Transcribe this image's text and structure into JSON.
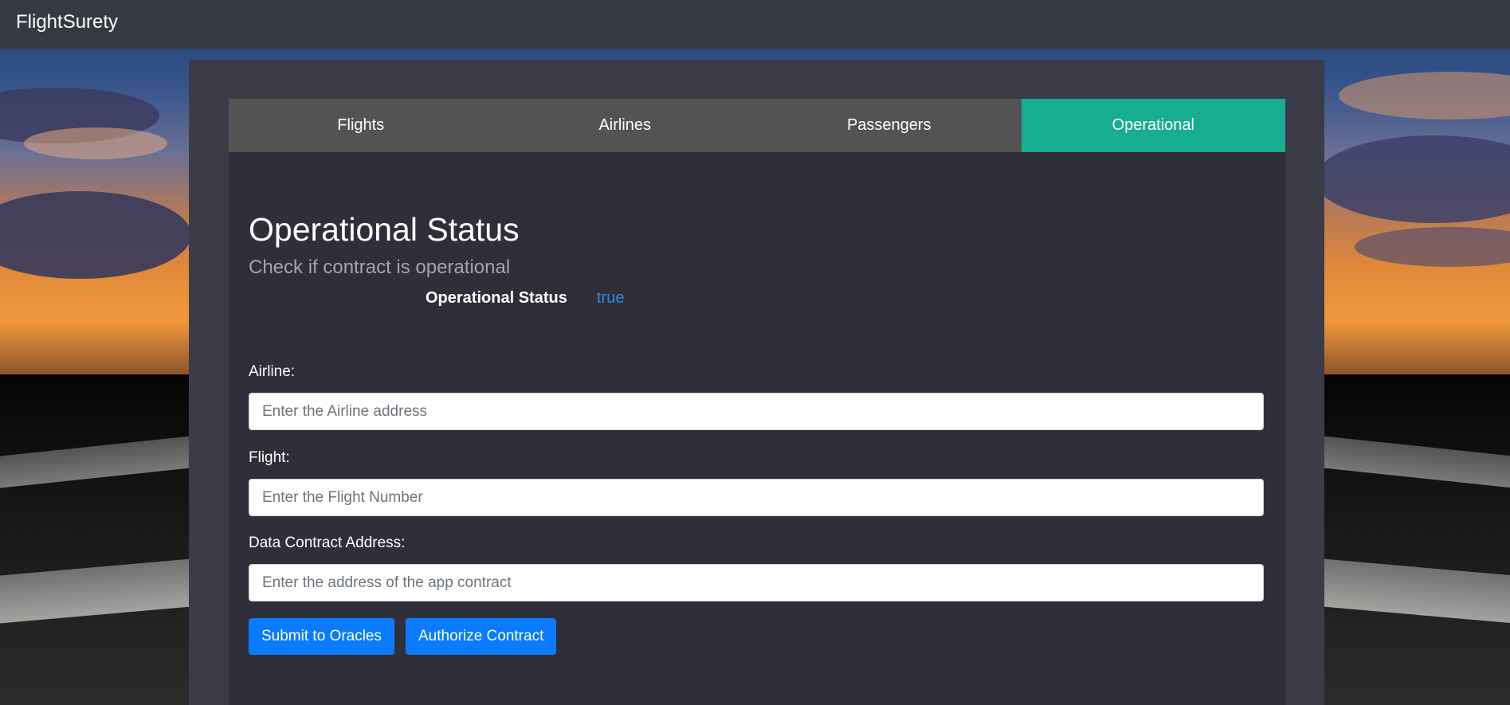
{
  "app": {
    "brand": "FlightSurety"
  },
  "tabs": [
    {
      "label": "Flights",
      "active": false
    },
    {
      "label": "Airlines",
      "active": false
    },
    {
      "label": "Passengers",
      "active": false
    },
    {
      "label": "Operational",
      "active": true
    }
  ],
  "operational": {
    "title": "Operational Status",
    "subtitle": "Check if contract is operational",
    "status_label": "Operational Status",
    "status_value": "true"
  },
  "form": {
    "airline_label": "Airline:",
    "airline_placeholder": "Enter the Airline address",
    "flight_label": "Flight:",
    "flight_placeholder": "Enter the Flight Number",
    "contract_label": "Data Contract Address:",
    "contract_placeholder": "Enter the address of the app contract"
  },
  "buttons": {
    "submit": "Submit to Oracles",
    "authorize": "Authorize Contract"
  },
  "colors": {
    "topbar": "#353942",
    "panel": "#3b3c47",
    "content": "#2f2f3a",
    "tab_inactive": "#535353",
    "tab_active": "#17ad8f",
    "status_value": "#2a8ae0",
    "button": "#0a7bff"
  }
}
